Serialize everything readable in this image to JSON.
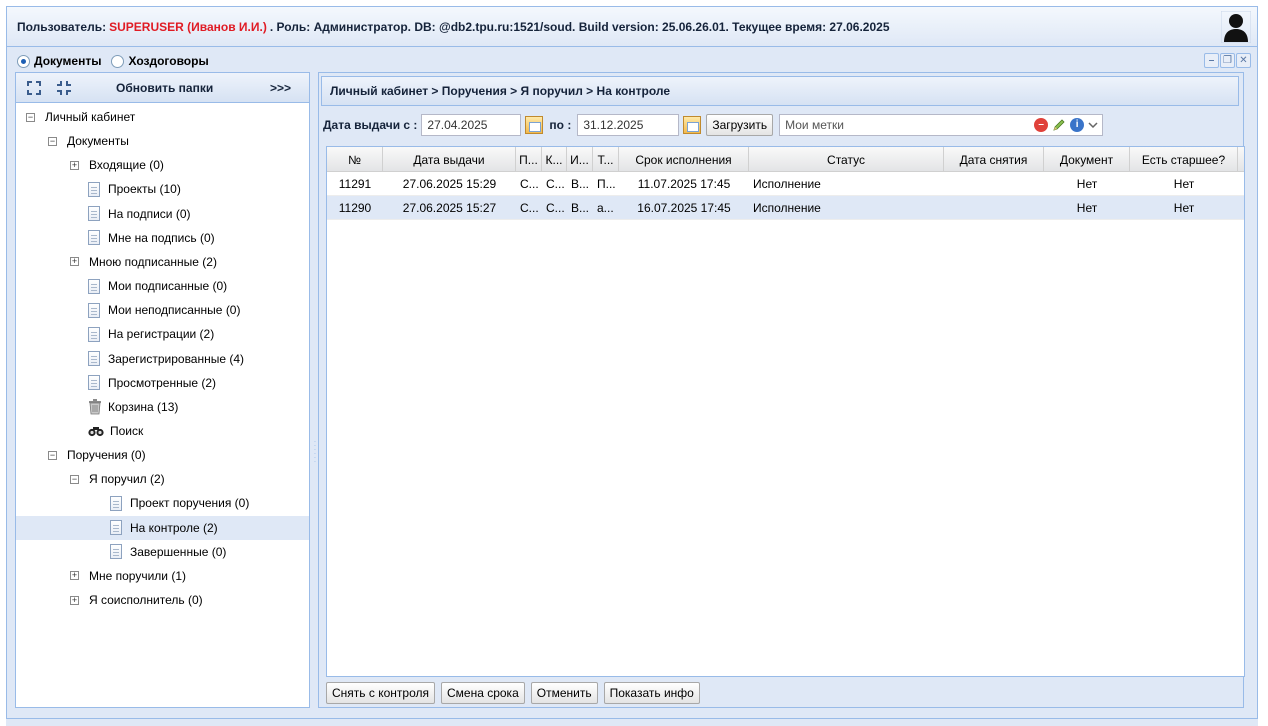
{
  "header": {
    "user_label": "Пользователь:",
    "user_name": "SUPERUSER (Иванов И.И.)",
    "rest": ". Роль: Администратор. DB: @db2.tpu.ru:1521/soud. Build version: 25.06.26.01. Текущее время: 27.06.2025"
  },
  "mode": {
    "documents": "Документы",
    "contracts": "Хоздоговоры"
  },
  "left": {
    "refresh_label": "Обновить папки",
    "more_label": ">>>",
    "tree": [
      {
        "label": "Личный кабинет",
        "indent": 0,
        "kind": "minus"
      },
      {
        "label": "Документы",
        "indent": 1,
        "kind": "minus"
      },
      {
        "label": "Входящие (0)",
        "indent": 2,
        "kind": "plus"
      },
      {
        "label": "Проекты (10)",
        "indent": 3,
        "kind": "doc"
      },
      {
        "label": "На подписи (0)",
        "indent": 3,
        "kind": "doc"
      },
      {
        "label": "Мне на подпись (0)",
        "indent": 3,
        "kind": "doc"
      },
      {
        "label": "Мною подписанные (2)",
        "indent": 2,
        "kind": "plus"
      },
      {
        "label": "Мои подписанные (0)",
        "indent": 3,
        "kind": "doc"
      },
      {
        "label": "Мои неподписанные (0)",
        "indent": 3,
        "kind": "doc"
      },
      {
        "label": "На регистрации (2)",
        "indent": 3,
        "kind": "doc"
      },
      {
        "label": "Зарегистрированные (4)",
        "indent": 3,
        "kind": "doc"
      },
      {
        "label": "Просмотренные (2)",
        "indent": 3,
        "kind": "doc"
      },
      {
        "label": "Корзина (13)",
        "indent": 3,
        "kind": "trash"
      },
      {
        "label": "Поиск",
        "indent": 3,
        "kind": "search"
      },
      {
        "label": "Поручения (0)",
        "indent": 1,
        "kind": "minus"
      },
      {
        "label": "Я поручил (2)",
        "indent": 2,
        "kind": "minus"
      },
      {
        "label": "Проект поручения (0)",
        "indent": 4,
        "kind": "doc"
      },
      {
        "label": "На контроле (2)",
        "indent": 4,
        "kind": "doc",
        "selected": true
      },
      {
        "label": "Завершенные (0)",
        "indent": 4,
        "kind": "doc"
      },
      {
        "label": "Мне поручили (1)",
        "indent": 2,
        "kind": "plus"
      },
      {
        "label": "Я соисполнитель (0)",
        "indent": 2,
        "kind": "plus"
      }
    ]
  },
  "right": {
    "breadcrumb": "Личный кабинет > Поручения > Я поручил > На контроле",
    "filter": {
      "from_label": "Дата выдачи с :",
      "from_value": "27.04.2025",
      "to_label": "по :",
      "to_value": "31.12.2025",
      "load_label": "Загрузить",
      "tags_placeholder": "Мои метки"
    },
    "columns": [
      "№",
      "Дата выдачи",
      "П...",
      "К...",
      "И...",
      "Т...",
      "Срок исполнения",
      "Статус",
      "Дата снятия",
      "Документ",
      "Есть старшее?"
    ],
    "rows": [
      [
        "11291",
        "27.06.2025 15:29",
        "С...",
        "С...",
        "В...",
        "П...",
        "11.07.2025 17:45",
        "Исполнение",
        "",
        "Нет",
        "Нет"
      ],
      [
        "11290",
        "27.06.2025 15:27",
        "С...",
        "С...",
        "В...",
        "а...",
        "16.07.2025 17:45",
        "Исполнение",
        "",
        "Нет",
        "Нет"
      ]
    ],
    "selected_row": 1,
    "buttons": {
      "remove_control": "Снять с контроля",
      "change_term": "Смена срока",
      "cancel": "Отменить",
      "show_info": "Показать инфо"
    }
  }
}
